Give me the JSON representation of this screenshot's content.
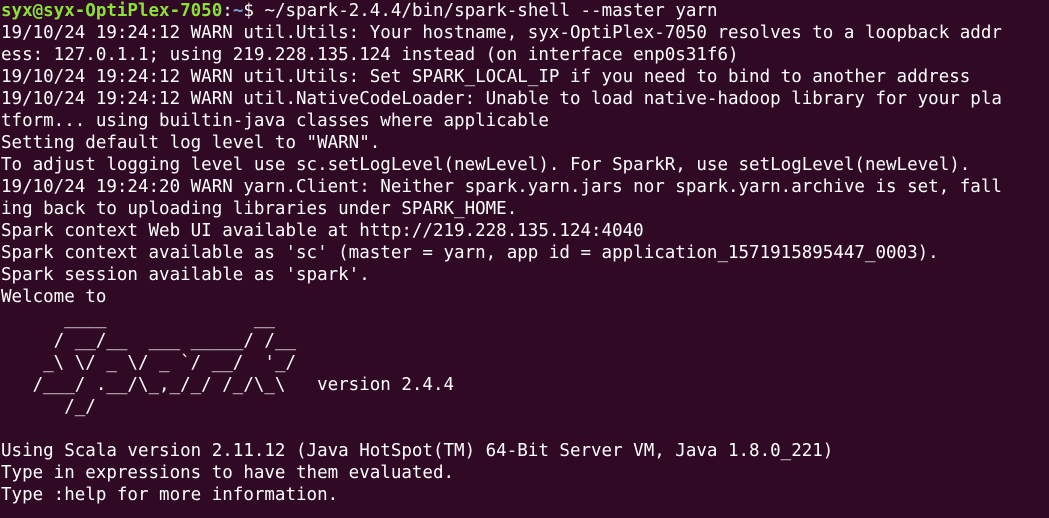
{
  "colors": {
    "background": "#300a24",
    "foreground": "#ffffff",
    "prompt_user": "#8ae234",
    "prompt_path": "#729fcf"
  },
  "prompt": {
    "user_host": "syx@syx-OptiPlex-7050",
    "separator": ":",
    "path": "~",
    "symbol": "$ ",
    "command": "~/spark-2.4.4/bin/spark-shell --master yarn"
  },
  "output_lines": [
    "19/10/24 19:24:12 WARN util.Utils: Your hostname, syx-OptiPlex-7050 resolves to a loopback addr",
    "ess: 127.0.1.1; using 219.228.135.124 instead (on interface enp0s31f6)",
    "19/10/24 19:24:12 WARN util.Utils: Set SPARK_LOCAL_IP if you need to bind to another address",
    "19/10/24 19:24:12 WARN util.NativeCodeLoader: Unable to load native-hadoop library for your pla",
    "tform... using builtin-java classes where applicable",
    "Setting default log level to \"WARN\".",
    "To adjust logging level use sc.setLogLevel(newLevel). For SparkR, use setLogLevel(newLevel).",
    "19/10/24 19:24:20 WARN yarn.Client: Neither spark.yarn.jars nor spark.yarn.archive is set, fall",
    "ing back to uploading libraries under SPARK_HOME.",
    "Spark context Web UI available at http://219.228.135.124:4040",
    "Spark context available as 'sc' (master = yarn, app id = application_1571915895447_0003).",
    "Spark session available as 'spark'.",
    "Welcome to",
    "      ____              __",
    "     / __/__  ___ _____/ /__",
    "    _\\ \\/ _ \\/ _ `/ __/  '_/",
    "   /___/ .__/\\_,_/_/ /_/\\_\\   version 2.4.4",
    "      /_/",
    "",
    "Using Scala version 2.11.12 (Java HotSpot(TM) 64-Bit Server VM, Java 1.8.0_221)",
    "Type in expressions to have them evaluated.",
    "Type :help for more information."
  ]
}
